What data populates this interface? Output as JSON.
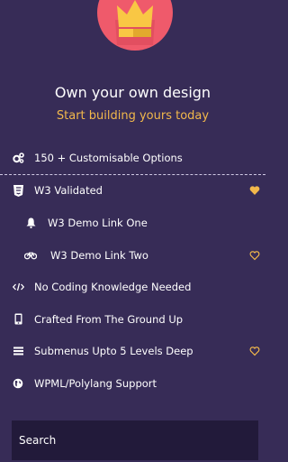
{
  "hero": {
    "logo_icon": "crown-icon",
    "title": "Own your own design",
    "subtitle": "Start building yours today"
  },
  "menu": {
    "items": [
      {
        "label": "150 + Customisable Options",
        "icon": "cogs-icon"
      },
      {
        "label": "W3 Validated",
        "icon": "css3-icon",
        "heart": "filled"
      },
      {
        "label": "W3 Demo Link One",
        "icon": "bell-icon"
      },
      {
        "label": "W3 Demo Link Two",
        "icon": "bicycle-icon",
        "heart": "outline"
      },
      {
        "label": "No Coding Knowledge Needed",
        "icon": "code-icon"
      },
      {
        "label": "Crafted From The Ground Up",
        "icon": "mobile-icon"
      },
      {
        "label": "Submenus Upto 5 Levels Deep",
        "icon": "bars-icon",
        "heart": "outline"
      },
      {
        "label": "WPML/Polylang Support",
        "icon": "globe-icon"
      }
    ]
  },
  "search": {
    "placeholder": "Search"
  },
  "colors": {
    "background": "#372c57",
    "accent": "#f2b84b",
    "logo": "#ef5a6b",
    "search_bg": "#221a3a"
  }
}
